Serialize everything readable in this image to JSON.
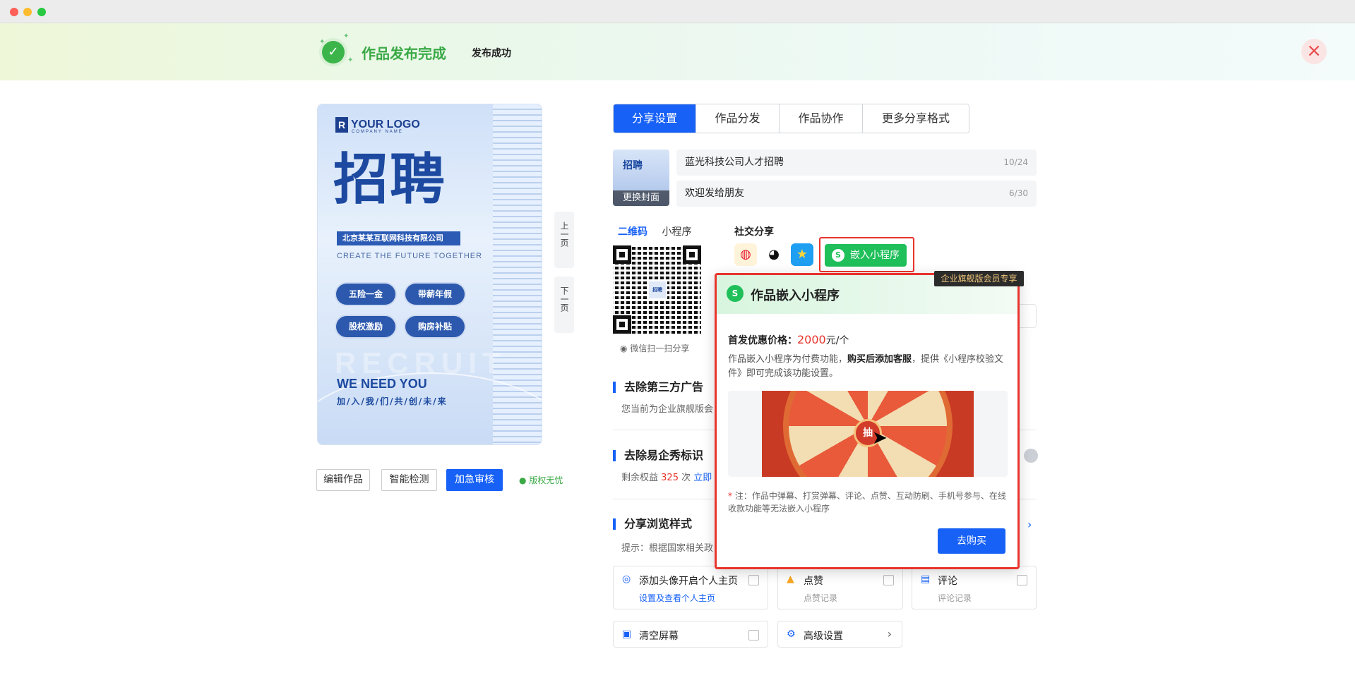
{
  "banner": {
    "title": "作品发布完成",
    "subtitle": "发布成功",
    "close_icon": "close-icon"
  },
  "poster": {
    "logo_text": "YOUR LOGO",
    "logo_sub": "COMPANY NAME",
    "headline": "招聘",
    "company": "北京某某互联网科技有限公司",
    "slogan": "CREATE THE FUTURE TOGETHER",
    "benefits": [
      "五险一金",
      "带薪年假",
      "股权激励",
      "购房补贴"
    ],
    "watermark": "RECRUIT",
    "we_need": "WE NEED YOU",
    "join": "加/入/我/们/共/创/未/来"
  },
  "page_nav": {
    "prev": "上一页",
    "next": "下一页"
  },
  "poster_actions": {
    "edit": "编辑作品",
    "detect": "智能检测",
    "expedite": "加急审核",
    "copyright": "版权无忧"
  },
  "tabs": [
    "分享设置",
    "作品分发",
    "作品协作",
    "更多分享格式"
  ],
  "cover": {
    "mini": "招聘",
    "change": "更换封面"
  },
  "share_title": {
    "value": "蓝光科技公司人才招聘",
    "count": "10/24"
  },
  "share_desc": {
    "value": "欢迎发给朋友",
    "count": "6/30"
  },
  "qr": {
    "tabs": [
      "二维码",
      "小程序"
    ],
    "center": "招聘",
    "caption": "微信扫一扫分享"
  },
  "social": {
    "title": "社交分享",
    "icons": [
      "weibo-icon",
      "qq-icon",
      "qzone-icon"
    ],
    "embed": "嵌入小程序"
  },
  "sections": {
    "ads_title": "去除第三方广告",
    "ads_sub": "您当前为企业旗舰版会",
    "brand_title": "去除易企秀标识",
    "brand_sub_prefix": "剩余权益",
    "brand_sub_num": "325",
    "brand_sub_unit": "次",
    "brand_sub_link": "立即",
    "browse_title": "分享浏览样式",
    "browse_sub": "提示：根据国家相关政"
  },
  "options": [
    {
      "label": "添加头像开启个人主页",
      "sub": "设置及查看个人主页"
    },
    {
      "label": "点赞",
      "sub": "点赞记录"
    },
    {
      "label": "评论",
      "sub": "评论记录"
    },
    {
      "label": "清空屏幕"
    },
    {
      "label": "高级设置"
    }
  ],
  "popup": {
    "badge": "企业旗舰版会员专享",
    "title": "作品嵌入小程序",
    "price_label": "首发优惠价格：",
    "price_amount": "2000",
    "price_unit": "元/个",
    "desc_1": "作品嵌入小程序为付费功能，",
    "desc_bold": "购买后添加客服",
    "desc_2": "，提供《小程序校验文件》即可完成该功能设置。",
    "note": "注：作品中弹幕、打赏弹幕、评论、点赞、互动防刷、手机号参与、在线收款功能等无法嵌入小程序",
    "buy": "去购买"
  },
  "colors": {
    "primary": "#1761f6",
    "success": "#3aa946",
    "danger": "#e8342c",
    "wechat": "#1fbf5a"
  }
}
